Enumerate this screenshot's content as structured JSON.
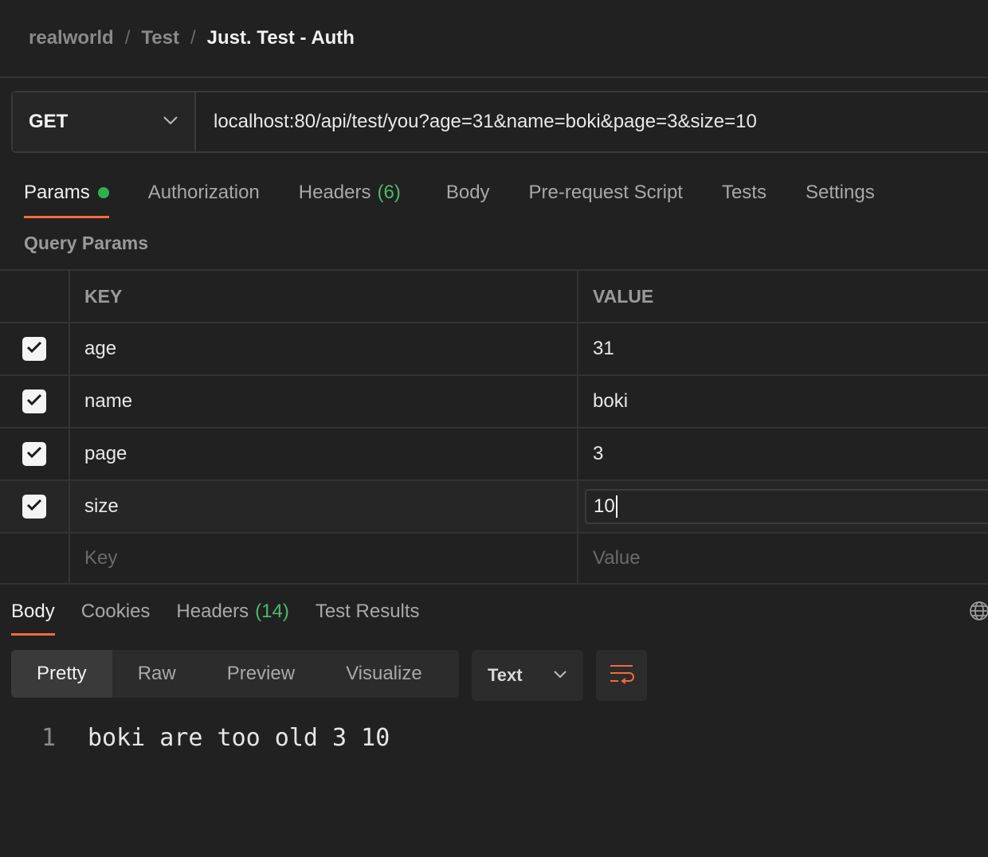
{
  "breadcrumb": {
    "workspace": "realworld",
    "collection": "Test",
    "request": "Just. Test - Auth",
    "separator": "/"
  },
  "request": {
    "method": "GET",
    "url": "localhost:80/api/test/you?age=31&name=boki&page=3&size=10"
  },
  "tabs": [
    {
      "label": "Params",
      "active": true,
      "dot": true
    },
    {
      "label": "Authorization"
    },
    {
      "label": "Headers",
      "count": "(6)"
    },
    {
      "label": "Body"
    },
    {
      "label": "Pre-request Script"
    },
    {
      "label": "Tests"
    },
    {
      "label": "Settings"
    }
  ],
  "query_params": {
    "title": "Query Params",
    "columns": {
      "key": "KEY",
      "value": "VALUE"
    },
    "rows": [
      {
        "key": "age",
        "value": "31",
        "checked": true
      },
      {
        "key": "name",
        "value": "boki",
        "checked": true
      },
      {
        "key": "page",
        "value": "3",
        "checked": true
      },
      {
        "key": "size",
        "value": "10",
        "checked": true,
        "editing": true
      }
    ],
    "placeholders": {
      "key": "Key",
      "value": "Value"
    }
  },
  "response": {
    "tabs": [
      {
        "label": "Body",
        "active": true
      },
      {
        "label": "Cookies"
      },
      {
        "label": "Headers",
        "count": "(14)"
      },
      {
        "label": "Test Results"
      }
    ],
    "view_modes": [
      "Pretty",
      "Raw",
      "Preview",
      "Visualize"
    ],
    "active_view": "Pretty",
    "format": "Text",
    "lines": [
      {
        "num": "1",
        "text": "boki are too old 3 10"
      }
    ]
  },
  "colors": {
    "accent": "#f26b3a",
    "success": "#2fb14e",
    "count": "#4fb86a",
    "background": "#212121"
  },
  "icons": {
    "method_dropdown": "chevron-down-icon",
    "format_dropdown": "chevron-down-icon",
    "wrap": "word-wrap-icon",
    "globe": "globe-icon",
    "checkbox": "check-icon"
  }
}
